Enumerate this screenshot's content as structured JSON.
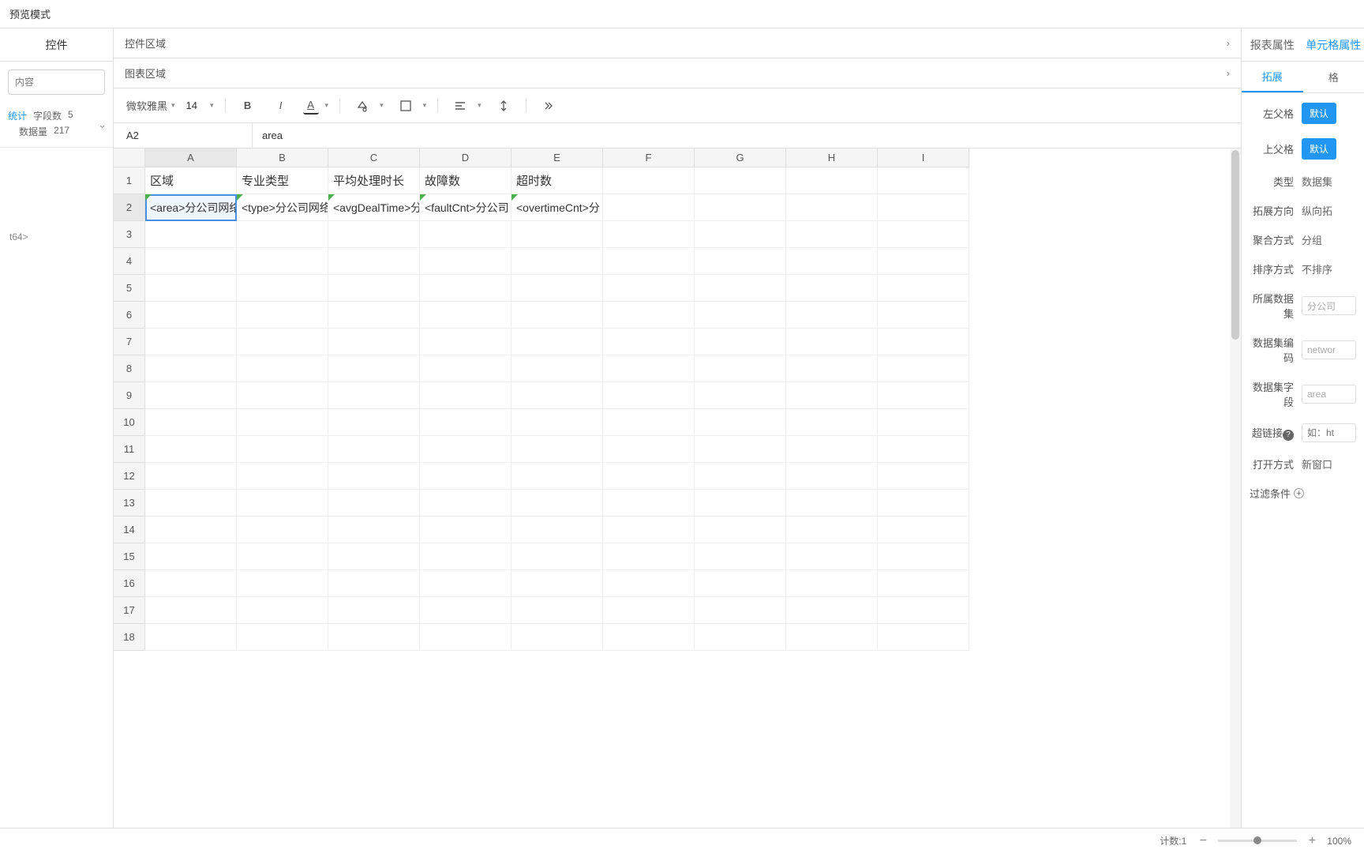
{
  "topbar": {
    "preview_mode": "预览模式"
  },
  "left": {
    "title": "控件",
    "search_placeholder": "内容",
    "stat_label": "统计",
    "field_count_label": "字段数",
    "field_count": "5",
    "data_count_label": "数据量",
    "data_count": "217",
    "field1": "t64>"
  },
  "center": {
    "section_controls": "控件区域",
    "section_chart": "图表区域",
    "font_family": "微软雅黑",
    "font_size": "14",
    "cell_ref": "A2",
    "cell_formula": "area",
    "columns": [
      "A",
      "B",
      "C",
      "D",
      "E",
      "F",
      "G",
      "H",
      "I"
    ],
    "rows": [
      "1",
      "2",
      "3",
      "4",
      "5",
      "6",
      "7",
      "8",
      "9",
      "10",
      "11",
      "12",
      "13",
      "14",
      "15",
      "16",
      "17",
      "18"
    ],
    "header_row": [
      "区域",
      "专业类型",
      "平均处理时长",
      "故障数",
      "超时数"
    ],
    "data_row": [
      "<area>分公司网络",
      "<type>分公司网络",
      "<avgDealTime>分",
      "<faultCnt>分公司",
      "<overtimeCnt>分"
    ]
  },
  "right": {
    "tab_report": "报表属性",
    "tab_cell": "单元格属性",
    "subtab_expand": "拓展",
    "subtab_format": "格",
    "left_parent": "左父格",
    "top_parent": "上父格",
    "default_btn": "默认",
    "type_label": "类型",
    "type_value": "数据集",
    "expand_dir_label": "拓展方向",
    "expand_dir_value": "纵向拓",
    "agg_label": "聚合方式",
    "agg_value": "分组",
    "sort_label": "排序方式",
    "sort_value": "不排序",
    "dataset_label": "所属数据集",
    "dataset_value": "分公司",
    "dataset_code_label": "数据集编码",
    "dataset_code_value": "networ",
    "dataset_field_label": "数据集字段",
    "dataset_field_value": "area",
    "hyperlink_label": "超链接",
    "hyperlink_placeholder": "如：ht",
    "open_label": "打开方式",
    "open_value": "新窗口",
    "filter_label": "过滤条件"
  },
  "bottom": {
    "count_label": "计数:",
    "count": "1",
    "zoom": "100%"
  }
}
